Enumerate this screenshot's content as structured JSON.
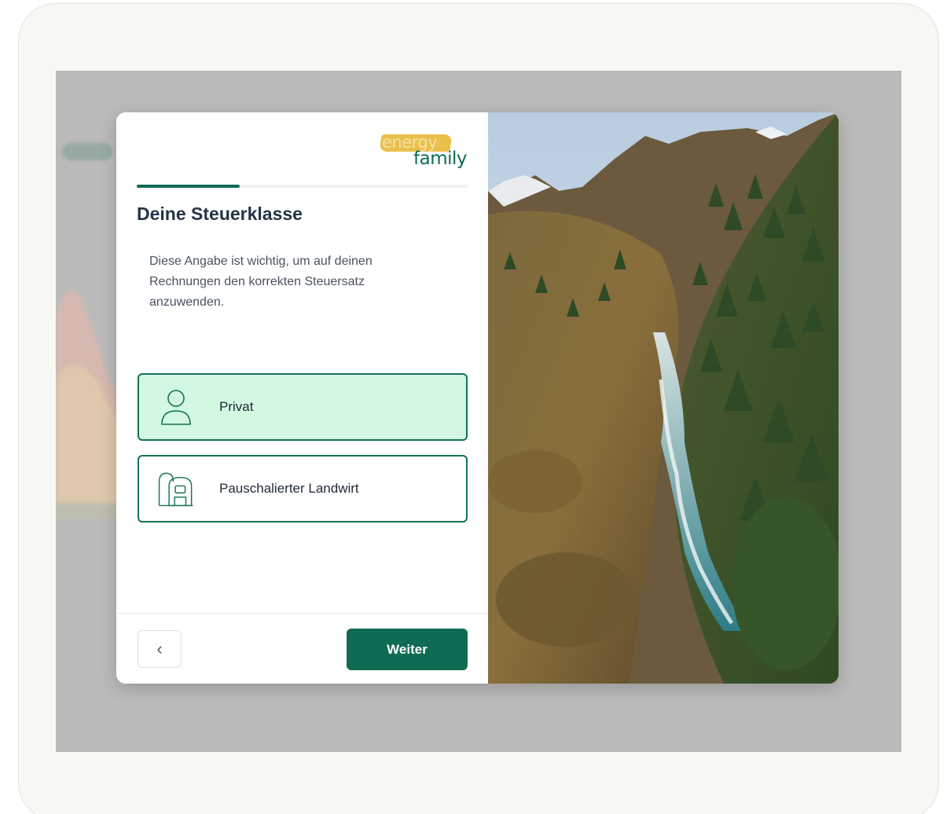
{
  "logo": {
    "line1": "energy",
    "line2": "family"
  },
  "step": {
    "progress": 0.31
  },
  "title": "Deine Steuerklasse",
  "description": "Diese Angabe ist wichtig, um auf deinen Rechnungen den korrekten Steuersatz anzuwenden.",
  "options": [
    {
      "label": "Privat",
      "icon": "person-icon",
      "selected": true
    },
    {
      "label": "Pauschalierter Landwirt",
      "icon": "farm-silo-icon",
      "selected": false
    }
  ],
  "footer": {
    "back_icon": "chevron-left-icon",
    "back_glyph": "‹",
    "next_label": "Weiter"
  },
  "colors": {
    "brand_green": "#0f6b53",
    "brand_yellow": "#e9c04b",
    "selected_bg": "#d2f8e1",
    "backdrop": "#bababa"
  },
  "image": {
    "subject": "mountain valley with river and pine forest"
  }
}
